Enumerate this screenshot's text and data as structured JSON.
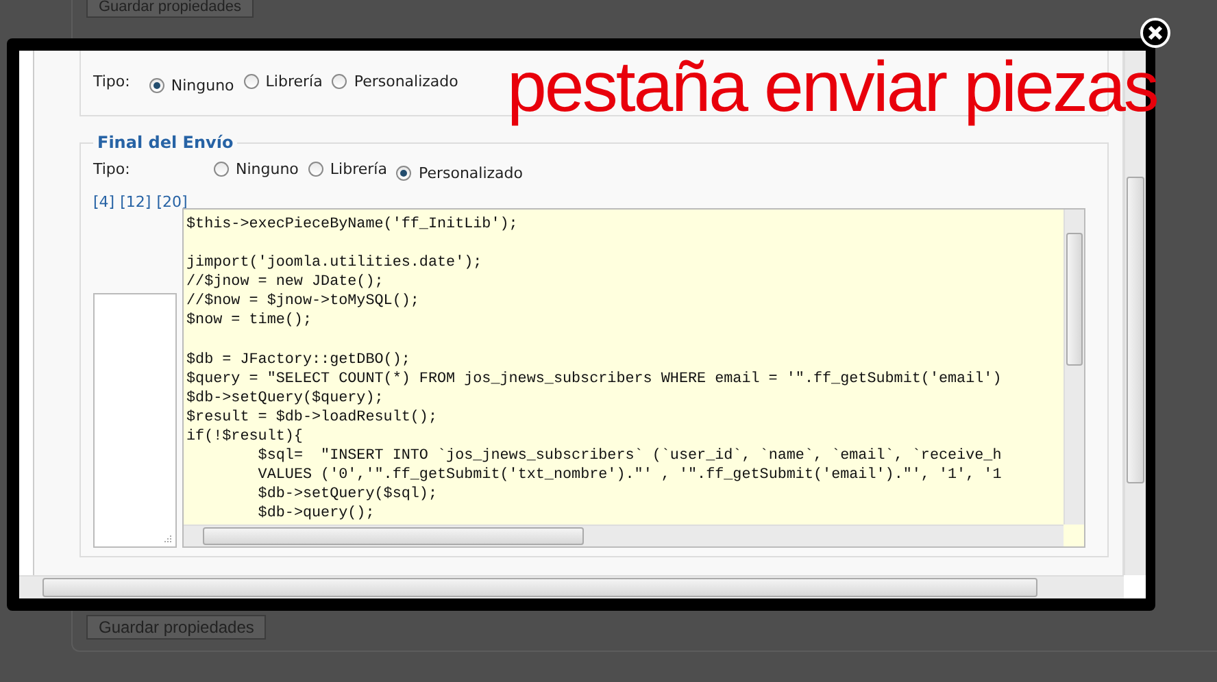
{
  "page": {
    "buttons": [
      {
        "label": "Guardar propiedades"
      },
      {
        "label": "Guardar propiedades"
      }
    ]
  },
  "modal": {
    "caption": "pestaña enviar piezas",
    "top_section": {
      "type_label": "Tipo:",
      "options": [
        {
          "label": "Ninguno",
          "selected": true
        },
        {
          "label": "Librería",
          "selected": false
        },
        {
          "label": "Personalizado",
          "selected": false
        }
      ]
    },
    "final_section": {
      "legend": "Final del Envío",
      "type_label": "Tipo:",
      "options": [
        {
          "label": "Ninguno",
          "selected": false
        },
        {
          "label": "Librería",
          "selected": false
        },
        {
          "label": "Personalizado",
          "selected": true
        }
      ],
      "links": [
        "[4]",
        "[12]",
        "[20]"
      ],
      "code": "$this->execPieceByName('ff_InitLib');\n\njimport('joomla.utilities.date');\n//$jnow = new JDate();\n//$now = $jnow->toMySQL();\n$now = time();\n\n$db = JFactory::getDBO();\n$query = \"SELECT COUNT(*) FROM jos_jnews_subscribers WHERE email = '\".ff_getSubmit('email')\n$db->setQuery($query);\n$result = $db->loadResult();\nif(!$result){\n\t$sql=  \"INSERT INTO `jos_jnews_subscribers` (`user_id`, `name`, `email`, `receive_h\n\tVALUES ('0','\".ff_getSubmit('txt_nombre').\"' , '\".ff_getSubmit('email').\"', '1', '1\n\t$db->setQuery($sql);\n\t$db->query();"
    }
  }
}
